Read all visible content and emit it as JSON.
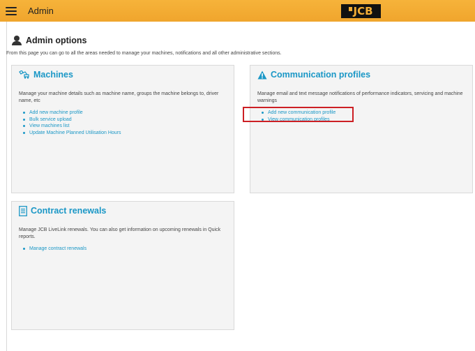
{
  "header": {
    "app_title": "Admin",
    "logo_text": "JCB",
    "accent": "#f2a92f"
  },
  "page": {
    "title": "Admin options",
    "description": "From this page you can go to all the areas needed to manage your machines, notifications and all other administrative sections."
  },
  "cards": {
    "machines": {
      "title": "Machines",
      "icon": "excavator-icon",
      "description": "Manage your machine details such as machine name, groups the machine belongs to, driver name, etc",
      "links": [
        "Add new machine profile",
        "Bulk service upload",
        "View machines list",
        "Update Machine Planned Utilisation Hours"
      ]
    },
    "communication": {
      "title": "Communication profiles",
      "icon": "warning-icon",
      "description": "Manage email and text message notifications of performance indicators, servicing and machine warnings",
      "links": [
        "Add new communication profile",
        "View communication profiles"
      ]
    },
    "contracts": {
      "title": "Contract renewals",
      "icon": "document-icon",
      "description": "Manage JCB LiveLink renewals. You can also get information on upcoming renewals in Quick reports.",
      "links": [
        "Manage contract renewals"
      ]
    }
  },
  "colors": {
    "link": "#1a97c6",
    "highlight": "#cc1f24"
  }
}
